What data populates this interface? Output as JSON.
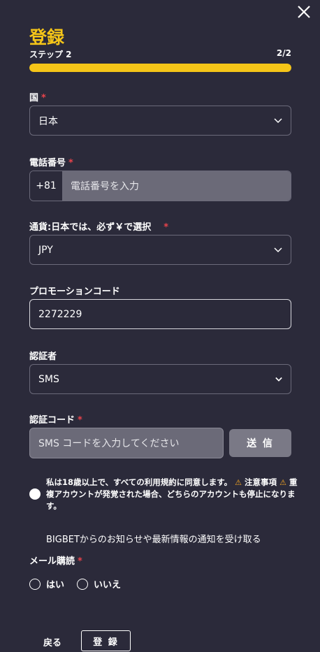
{
  "close_icon": "close-icon",
  "title": "登録",
  "step": {
    "label": "ステップ 2",
    "counter": "2/2",
    "progress": 1.0
  },
  "country": {
    "label": "国",
    "required": "*",
    "value": "日本"
  },
  "phone": {
    "label": "電話番号",
    "required": "*",
    "code": "+81",
    "placeholder": "電話番号を入力"
  },
  "currency": {
    "label": "通貨:日本では、必ず￥で選択",
    "required": "*",
    "value": "JPY"
  },
  "promo": {
    "label": "プロモーションコード",
    "value": "2272229"
  },
  "verifier": {
    "label": "認証者",
    "value": "SMS"
  },
  "verify_code": {
    "label": "認証コード",
    "required": "*",
    "placeholder": "SMS コードを入力してください",
    "send_label": "送 信"
  },
  "agreement": {
    "text_1": "私は18歳以上で、すべての利用規約に同意します。",
    "warn_icon": "warning-icon",
    "notice": "注意事項",
    "text_2": "重複アカウントが発覚された場合、どちらのアカウントも停止になります。"
  },
  "newsletter": {
    "text": "BIGBETからのお知らせや最新情報の通知を受け取る"
  },
  "mail": {
    "label": "メール購読",
    "required": "*",
    "yes": "はい",
    "no": "いいえ"
  },
  "footer": {
    "back": "戻る",
    "register": "登 録"
  },
  "colors": {
    "accent": "#f5c518",
    "background": "#2b2a3a",
    "required": "#e8434b"
  }
}
